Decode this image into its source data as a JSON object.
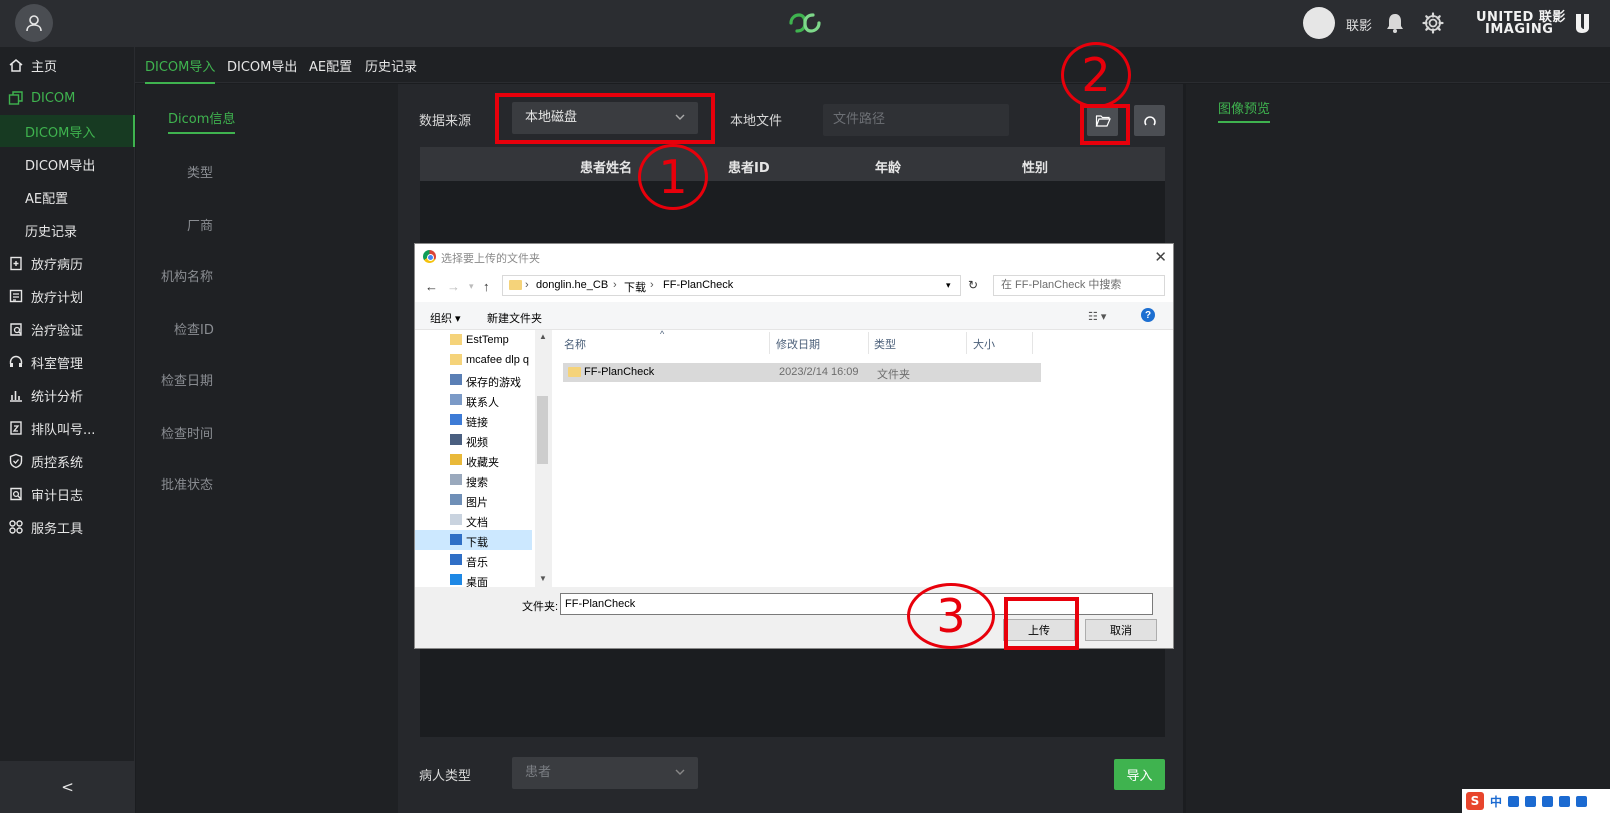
{
  "topbar": {
    "user_name": "联影",
    "brand_line1": "UNITED 联影",
    "brand_line2": "IMAGING"
  },
  "sidebar": {
    "items": [
      {
        "label": "主页",
        "icon": "home-icon"
      },
      {
        "label": "DICOM",
        "icon": "window-icon"
      },
      {
        "label": "DICOM导入"
      },
      {
        "label": "DICOM导出"
      },
      {
        "label": "AE配置"
      },
      {
        "label": "历史记录"
      },
      {
        "label": "放疗病历",
        "icon": "clipboard-icon"
      },
      {
        "label": "放疗计划",
        "icon": "document-icon"
      },
      {
        "label": "治疗验证",
        "icon": "verify-icon"
      },
      {
        "label": "科室管理",
        "icon": "headset-icon"
      },
      {
        "label": "统计分析",
        "icon": "chart-icon"
      },
      {
        "label": "排队叫号...",
        "icon": "queue-icon"
      },
      {
        "label": "质控系统",
        "icon": "shield-icon"
      },
      {
        "label": "审计日志",
        "icon": "audit-icon"
      },
      {
        "label": "服务工具",
        "icon": "apps-icon"
      }
    ],
    "collapse_label": "<"
  },
  "tabs": [
    "DICOM导入",
    "DICOM导出",
    "AE配置",
    "历史记录"
  ],
  "info_panel": {
    "title": "Dicom信息",
    "labels": [
      "类型",
      "厂商",
      "机构名称",
      "检查ID",
      "检查日期",
      "检查时间",
      "批准状态"
    ]
  },
  "main": {
    "source_label": "数据来源",
    "source_value": "本地磁盘",
    "local_file_label": "本地文件",
    "path_placeholder": "文件路径",
    "columns": [
      "患者姓名",
      "患者ID",
      "年龄",
      "性别"
    ],
    "patient_type_label": "病人类型",
    "patient_type_value": "患者",
    "import_button": "导入"
  },
  "preview": {
    "title": "图像预览"
  },
  "dialog": {
    "title": "选择要上传的文件夹",
    "path": [
      "donglin.he_CB",
      "下载",
      "FF-PlanCheck"
    ],
    "search_placeholder": "在 FF-PlanCheck 中搜索",
    "organize": "组织 ▾",
    "new_folder": "新建文件夹",
    "tree": [
      "EstTemp",
      "mcafee dlp q",
      "保存的游戏",
      "联系人",
      "链接",
      "视频",
      "收藏夹",
      "搜索",
      "图片",
      "文档",
      "下载",
      "音乐",
      "桌面"
    ],
    "columns": [
      "名称",
      "修改日期",
      "类型",
      "大小"
    ],
    "file": {
      "name": "FF-PlanCheck",
      "date": "2023/2/14 16:09",
      "type": "文件夹",
      "size": ""
    },
    "folder_label": "文件夹:",
    "folder_value": "FF-PlanCheck",
    "upload_button": "上传",
    "cancel_button": "取消"
  },
  "annotations": {
    "step1": "1",
    "step2": "2",
    "step3": "3",
    "color": "#e8000b"
  },
  "tray": {
    "ime": "中"
  },
  "colors": {
    "accent": "#3fb34f",
    "background": "#1b1d20",
    "panel": "#26282c"
  }
}
